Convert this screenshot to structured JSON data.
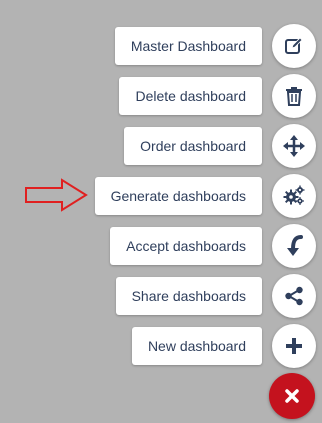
{
  "menu": {
    "items": [
      {
        "label": "Master Dashboard",
        "icon": "edit-icon"
      },
      {
        "label": "Delete dashboard",
        "icon": "trash-icon"
      },
      {
        "label": "Order dashboard",
        "icon": "move-icon"
      },
      {
        "label": "Generate dashboards",
        "icon": "gears-icon"
      },
      {
        "label": "Accept dashboards",
        "icon": "curved-arrow-down-icon"
      },
      {
        "label": "Share dashboards",
        "icon": "share-icon"
      },
      {
        "label": "New dashboard",
        "icon": "plus-icon"
      }
    ],
    "close_icon": "close-icon"
  },
  "colors": {
    "background": "#b3b3b3",
    "icon": "#2f3f5c",
    "close_button": "#c4121e",
    "pointer_arrow": "#e02020"
  }
}
